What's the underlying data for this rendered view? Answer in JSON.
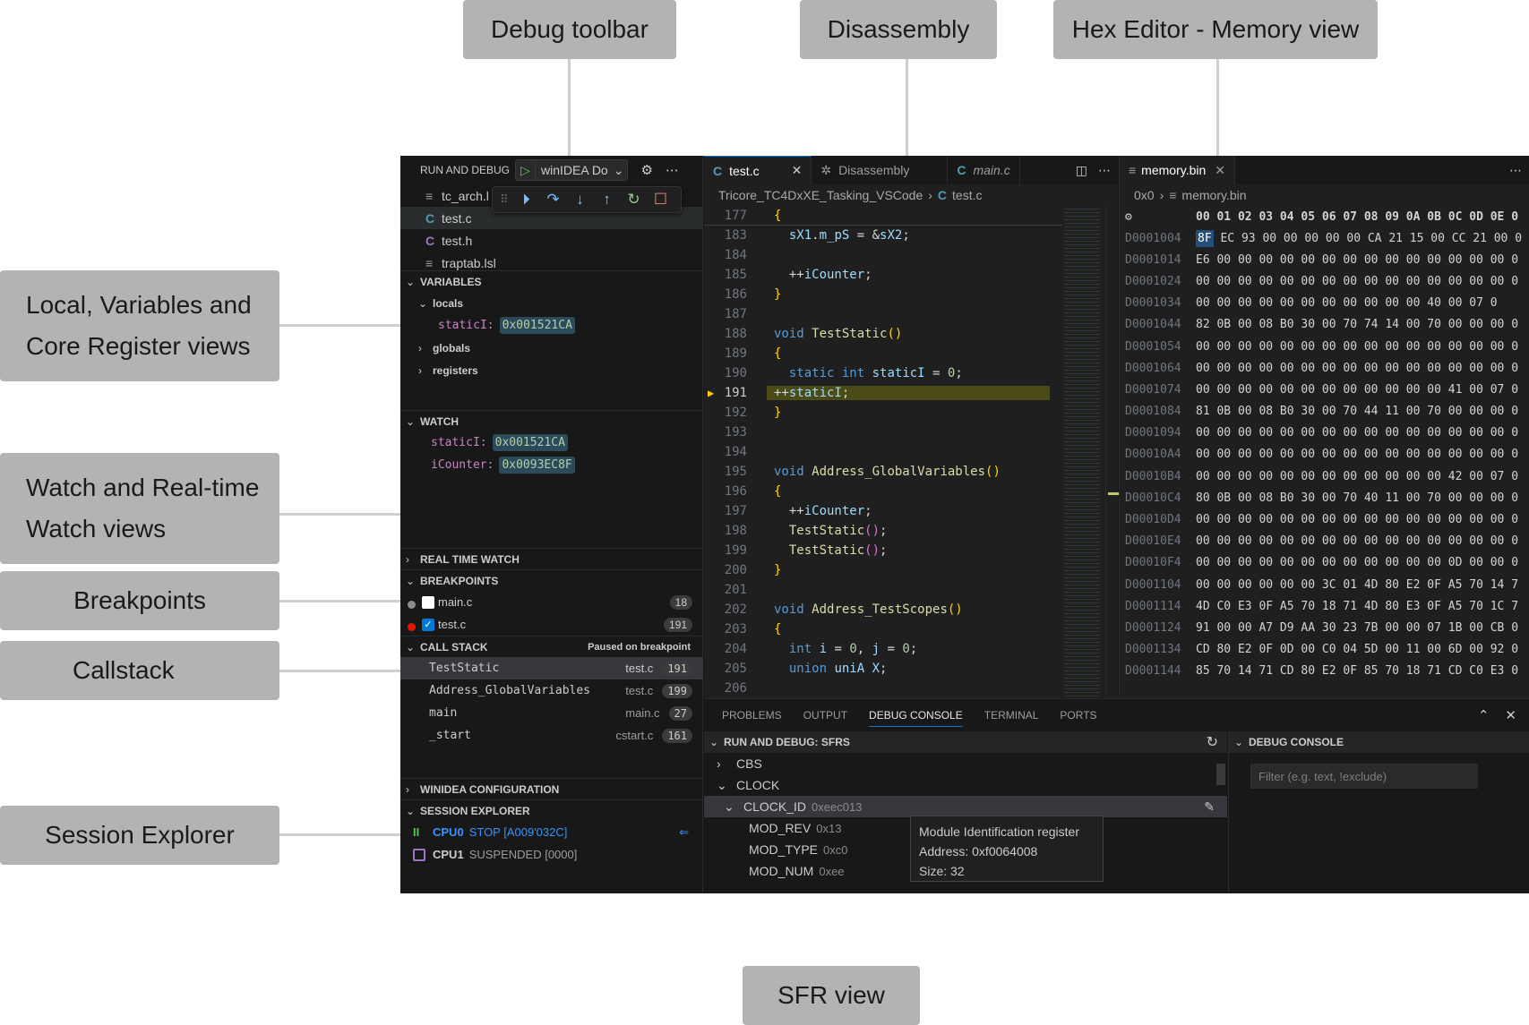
{
  "callouts": {
    "debug_toolbar": "Debug toolbar",
    "disassembly": "Disassembly",
    "hex_editor": "Hex Editor - Memory view",
    "locals_line1": "Local, Variables and",
    "locals_line2": "Core Register views",
    "watch_line1": "Watch and Real-time",
    "watch_line2": "Watch views",
    "breakpoints": "Breakpoints",
    "callstack": "Callstack",
    "session_explorer": "Session Explorer",
    "sfr_view": "SFR view"
  },
  "sidebar": {
    "title": "RUN AND DEBUG",
    "config": "winIDEA Do",
    "files": [
      {
        "icon": "doc",
        "name": "tc_arch.l"
      },
      {
        "icon": "c",
        "name": "test.c"
      },
      {
        "icon": "h",
        "name": "test.h"
      },
      {
        "icon": "doc",
        "name": "traptab.lsl"
      }
    ],
    "variables": {
      "title": "VARIABLES",
      "locals": "locals",
      "local_var": {
        "name": "staticI:",
        "value": "0x001521CA"
      },
      "globals": "globals",
      "registers": "registers"
    },
    "watch": {
      "title": "WATCH",
      "items": [
        {
          "name": "staticI:",
          "value": "0x001521CA"
        },
        {
          "name": "iCounter:",
          "value": "0x0093EC8F"
        }
      ]
    },
    "real_time_watch": "REAL TIME WATCH",
    "breakpoints": {
      "title": "BREAKPOINTS",
      "items": [
        {
          "file": "main.c",
          "line": "18",
          "enabled": false,
          "dot": "#8c8c8c"
        },
        {
          "file": "test.c",
          "line": "191",
          "enabled": true,
          "dot": "#e51400"
        }
      ]
    },
    "call_stack": {
      "title": "CALL STACK",
      "status": "Paused on breakpoint",
      "frames": [
        {
          "fn": "TestStatic",
          "file": "test.c",
          "line": "191"
        },
        {
          "fn": "Address_GlobalVariables",
          "file": "test.c",
          "line": "199"
        },
        {
          "fn": "main",
          "file": "main.c",
          "line": "27"
        },
        {
          "fn": "_start",
          "file": "cstart.c",
          "line": "161"
        }
      ]
    },
    "winidea_config": "WINIDEA CONFIGURATION",
    "session_explorer": {
      "title": "SESSION EXPLORER",
      "cpus": [
        {
          "name": "CPU0",
          "state": "STOP [A009'032C]",
          "color": "#3794ff"
        },
        {
          "name": "CPU1",
          "state": "SUSPENDED [0000]",
          "color": "#cccccc"
        }
      ]
    }
  },
  "editor": {
    "tabs": [
      {
        "label": "test.c",
        "active": true
      },
      {
        "label": "Disassembly",
        "active": false
      },
      {
        "label": "main.c",
        "active": false
      }
    ],
    "breadcrumb": {
      "folder": "Tricore_TC4DxXE_Tasking_VSCode",
      "file": "test.c"
    },
    "current_line": "191",
    "lines": [
      {
        "n": "177",
        "html": "<span class='br'>{</span>"
      },
      {
        "n": "183",
        "html": "  <span class='var'>sX1</span><span class='plain'>.</span><span class='var'>m_pS</span><span class='plain'> = &amp;</span><span class='var'>sX2</span><span class='plain'>;</span>"
      },
      {
        "n": "184",
        "html": ""
      },
      {
        "n": "185",
        "html": "  <span class='plain'>++</span><span class='var'>iCounter</span><span class='plain'>;</span>"
      },
      {
        "n": "186",
        "html": "<span class='br'>}</span>"
      },
      {
        "n": "187",
        "html": ""
      },
      {
        "n": "188",
        "html": "<span class='kw'>void</span> <span class='fn'>TestStatic</span><span class='br'>()</span>"
      },
      {
        "n": "189",
        "html": "<span class='br'>{</span>"
      },
      {
        "n": "190",
        "html": "  <span class='kw'>static</span> <span class='kw'>int</span> <span class='var'>staticI</span><span class='plain'> = </span><span class='num'>0</span><span class='plain'>;</span>"
      },
      {
        "n": "191",
        "html": "<span class='plain'>++</span><span class='var'>staticI</span><span class='plain'>;</span>"
      },
      {
        "n": "192",
        "html": "<span class='br'>}</span>"
      },
      {
        "n": "193",
        "html": ""
      },
      {
        "n": "194",
        "html": ""
      },
      {
        "n": "195",
        "html": "<span class='kw'>void</span> <span class='fn'>Address_GlobalVariables</span><span class='br'>()</span>"
      },
      {
        "n": "196",
        "html": "<span class='br'>{</span>"
      },
      {
        "n": "197",
        "html": "  <span class='plain'>++</span><span class='var'>iCounter</span><span class='plain'>;</span>"
      },
      {
        "n": "198",
        "html": "  <span class='fn'>TestStatic</span><span class='br2'>()</span><span class='plain'>;</span>"
      },
      {
        "n": "199",
        "html": "  <span class='fn'>TestStatic</span><span class='br2'>()</span><span class='plain'>;</span>"
      },
      {
        "n": "200",
        "html": "<span class='br'>}</span>"
      },
      {
        "n": "201",
        "html": ""
      },
      {
        "n": "202",
        "html": "<span class='kw'>void</span> <span class='fn'>Address_TestScopes</span><span class='br'>()</span>"
      },
      {
        "n": "203",
        "html": "<span class='br'>{</span>"
      },
      {
        "n": "204",
        "html": "  <span class='kw'>int</span> <span class='var'>i</span><span class='plain'> = </span><span class='num'>0</span><span class='plain'>, </span><span class='var'>j</span><span class='plain'> = </span><span class='num'>0</span><span class='plain'>;</span>"
      },
      {
        "n": "205",
        "html": "  <span class='kw'>union</span> <span class='var'>uniA</span> <span class='var'>X</span><span class='plain'>;</span>"
      },
      {
        "n": "206",
        "html": ""
      }
    ]
  },
  "hex": {
    "tab": "memory.bin",
    "breadcrumb": {
      "offset": "0x0",
      "file": "memory.bin"
    },
    "header": "00 01 02 03 04 05 06 07 08 09 0A 0B 0C 0D 0E 0",
    "rows": [
      {
        "addr": "D0001004",
        "first": "8F",
        "rest": " EC 93 00 00 00 00 00 CA 21 15 00 CC 21 00 0"
      },
      {
        "addr": "D0001014",
        "first": "E6",
        "rest": " 00 00 00 00 00 00 00 00 00 00 00 00 00 00 0"
      },
      {
        "addr": "D0001024",
        "first": "00",
        "rest": " 00 00 00 00 00 00 00 00 00 00 00 00 00 00 0"
      },
      {
        "addr": "D0001034",
        "first": "00",
        "rest": " 00 00 00 00 00 00 00 00 00 00 40 00 07 0"
      },
      {
        "addr": "D0001044",
        "first": "82",
        "rest": " 0B 00 08 B0 30 00 70 74 14 00 70 00 00 00 0"
      },
      {
        "addr": "D0001054",
        "first": "00",
        "rest": " 00 00 00 00 00 00 00 00 00 00 00 00 00 00 0"
      },
      {
        "addr": "D0001064",
        "first": "00",
        "rest": " 00 00 00 00 00 00 00 00 00 00 00 00 00 00 0"
      },
      {
        "addr": "D0001074",
        "first": "00",
        "rest": " 00 00 00 00 00 00 00 00 00 00 00 41 00 07 0"
      },
      {
        "addr": "D0001084",
        "first": "81",
        "rest": " 0B 00 08 B0 30 00 70 44 11 00 70 00 00 00 0"
      },
      {
        "addr": "D0001094",
        "first": "00",
        "rest": " 00 00 00 00 00 00 00 00 00 00 00 00 00 00 0"
      },
      {
        "addr": "D00010A4",
        "first": "00",
        "rest": " 00 00 00 00 00 00 00 00 00 00 00 00 00 00 0"
      },
      {
        "addr": "D00010B4",
        "first": "00",
        "rest": " 00 00 00 00 00 00 00 00 00 00 00 42 00 07 0"
      },
      {
        "addr": "D00010C4",
        "first": "80",
        "rest": " 0B 00 08 B0 30 00 70 40 11 00 70 00 00 00 0"
      },
      {
        "addr": "D00010D4",
        "first": "00",
        "rest": " 00 00 00 00 00 00 00 00 00 00 00 00 00 00 0"
      },
      {
        "addr": "D00010E4",
        "first": "00",
        "rest": " 00 00 00 00 00 00 00 00 00 00 00 00 00 00 0"
      },
      {
        "addr": "D00010F4",
        "first": "00",
        "rest": " 00 00 00 00 00 00 00 00 00 00 00 0D 00 00 0"
      },
      {
        "addr": "D0001104",
        "first": "00",
        "rest": " 00 00 00 00 00 3C 01 4D 80 E2 0F A5 70 14 7"
      },
      {
        "addr": "D0001114",
        "first": "4D",
        "rest": " C0 E3 0F A5 70 18 71 4D 80 E3 0F A5 70 1C 7"
      },
      {
        "addr": "D0001124",
        "first": "91",
        "rest": " 00 00 A7 D9 AA 30 23 7B 00 00 07 1B 00 CB 0"
      },
      {
        "addr": "D0001134",
        "first": "CD",
        "rest": " 80 E2 0F 0D 00 C0 04 5D 00 11 00 6D 00 92 0"
      },
      {
        "addr": "D0001144",
        "first": "85",
        "rest": " 70 14 71 CD 80 E2 0F 85 70 18 71 CD C0 E3 0"
      }
    ]
  },
  "panel": {
    "tabs": [
      "PROBLEMS",
      "OUTPUT",
      "DEBUG CONSOLE",
      "TERMINAL",
      "PORTS"
    ],
    "active_tab": "DEBUG CONSOLE",
    "sfr": {
      "title": "RUN AND DEBUG: SFRS",
      "groups": [
        {
          "name": "CBS",
          "expanded": false
        },
        {
          "name": "CLOCK",
          "expanded": true
        }
      ],
      "selected": {
        "name": "CLOCK_ID",
        "value": "0xeec013"
      },
      "fields": [
        {
          "name": "MOD_REV",
          "value": "0x13"
        },
        {
          "name": "MOD_TYPE",
          "value": "0xc0"
        },
        {
          "name": "MOD_NUM",
          "value": "0xee"
        }
      ],
      "tooltip": {
        "line1": "Module Identification register",
        "line2": "Address: 0xf0064008",
        "line3": "Size: 32"
      }
    },
    "debug_console": {
      "title": "DEBUG CONSOLE",
      "filter_placeholder": "Filter (e.g. text, !exclude)"
    }
  }
}
